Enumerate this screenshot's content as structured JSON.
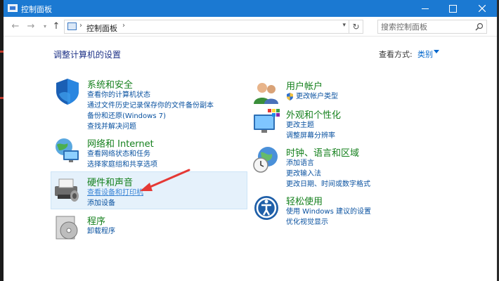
{
  "window": {
    "title": "控制面板"
  },
  "address_bar": {
    "crumb": "控制面板",
    "separator": "›"
  },
  "search": {
    "placeholder": "搜索控制面板"
  },
  "header": {
    "title": "调整计算机的设置",
    "view_label": "查看方式:",
    "view_value": "类别"
  },
  "categories": {
    "system_security": {
      "title": "系统和安全",
      "links": [
        "查看你的计算机状态",
        "通过文件历史记录保存你的文件备份副本",
        "备份和还原(Windows 7)",
        "查找并解决问题"
      ]
    },
    "network": {
      "title": "网络和 Internet",
      "links": [
        "查看网络状态和任务",
        "选择家庭组和共享选项"
      ]
    },
    "hardware": {
      "title": "硬件和声音",
      "links": [
        "查看设备和打印机",
        "添加设备"
      ]
    },
    "programs": {
      "title": "程序",
      "links": [
        "卸载程序"
      ]
    },
    "user_accounts": {
      "title": "用户帐户",
      "links": [
        "更改帐户类型"
      ]
    },
    "appearance": {
      "title": "外观和个性化",
      "links": [
        "更改主题",
        "调整屏幕分辨率"
      ]
    },
    "clock_region": {
      "title": "时钟、语言和区域",
      "links": [
        "添加语言",
        "更改输入法",
        "更改日期、时间或数字格式"
      ]
    },
    "ease_of_access": {
      "title": "轻松使用",
      "links": [
        "使用 Windows 建议的设置",
        "优化视觉显示"
      ]
    }
  },
  "colors": {
    "titlebar": "#1b79d2",
    "category_title": "#15801d",
    "link": "#0a52a0",
    "page_title": "#1e3287",
    "annotation_arrow": "#e53935"
  },
  "icons": {
    "system_security": "shield-icon",
    "network": "network-globe-icon",
    "hardware": "printer-icon",
    "programs": "programs-disc-icon",
    "user_accounts": "users-icon",
    "appearance": "monitor-palette-icon",
    "clock_region": "clock-globe-icon",
    "ease_of_access": "accessibility-icon"
  }
}
